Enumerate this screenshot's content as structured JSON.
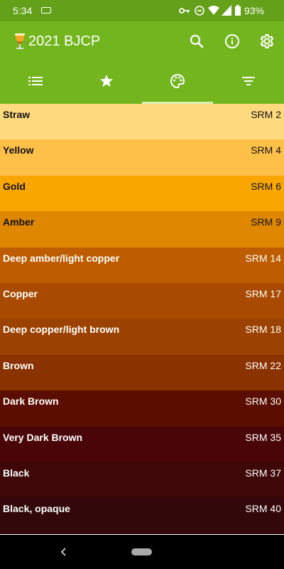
{
  "status": {
    "time": "5:34",
    "battery": "93%"
  },
  "app": {
    "title": "2021 BJCP"
  },
  "tabs": [
    {
      "icon": "list-icon",
      "selected": false
    },
    {
      "icon": "star-icon",
      "selected": false
    },
    {
      "icon": "palette-icon",
      "selected": true
    },
    {
      "icon": "filter-icon",
      "selected": false
    }
  ],
  "colors": [
    {
      "name": "Straw",
      "srm": "SRM 2",
      "bg": "#ffd97e",
      "fg": "#111111"
    },
    {
      "name": "Yellow",
      "srm": "SRM 4",
      "bg": "#ffc04a",
      "fg": "#111111"
    },
    {
      "name": "Gold",
      "srm": "SRM 6",
      "bg": "#f9a700",
      "fg": "#111111"
    },
    {
      "name": "Amber",
      "srm": "SRM 9",
      "bg": "#e08700",
      "fg": "#111111"
    },
    {
      "name": "Deep amber/light copper",
      "srm": "SRM 14",
      "bg": "#bd5d00",
      "fg": "#ffffff"
    },
    {
      "name": "Copper",
      "srm": "SRM 17",
      "bg": "#a84a00",
      "fg": "#ffffff"
    },
    {
      "name": "Deep copper/light brown",
      "srm": "SRM 18",
      "bg": "#9c4200",
      "fg": "#ffffff"
    },
    {
      "name": "Brown",
      "srm": "SRM 22",
      "bg": "#8a3200",
      "fg": "#ffffff"
    },
    {
      "name": "Dark Brown",
      "srm": "SRM 30",
      "bg": "#5b0d00",
      "fg": "#ffffff"
    },
    {
      "name": "Very Dark Brown",
      "srm": "SRM 35",
      "bg": "#4a0508",
      "fg": "#ffffff"
    },
    {
      "name": "Black",
      "srm": "SRM 37",
      "bg": "#3e0708",
      "fg": "#ffffff"
    },
    {
      "name": "Black, opaque",
      "srm": "SRM 40",
      "bg": "#32080a",
      "fg": "#ffffff"
    }
  ]
}
